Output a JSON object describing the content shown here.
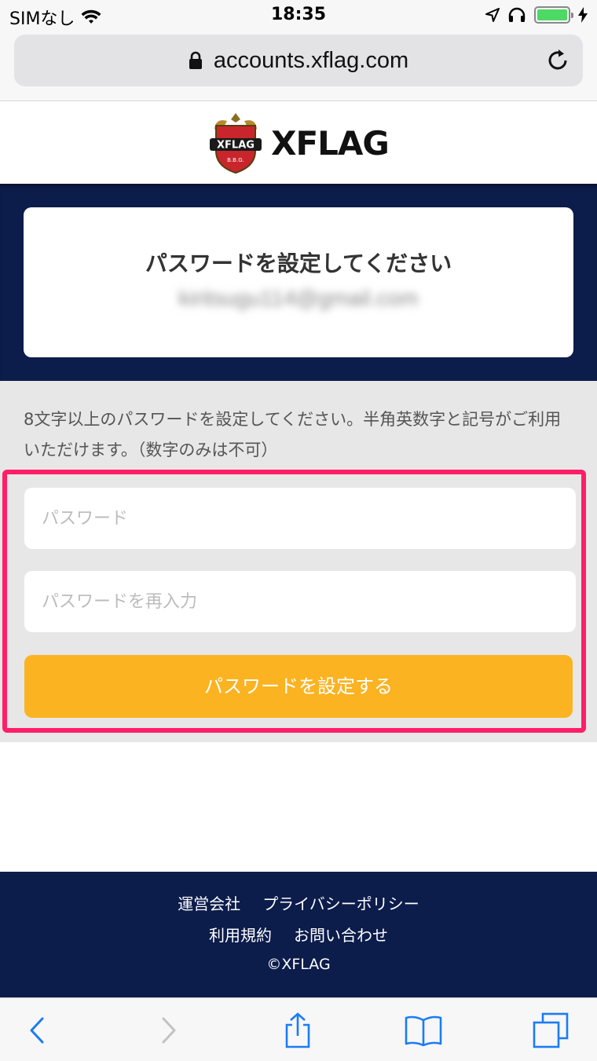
{
  "status_bar": {
    "carrier": "SIMなし",
    "time": "18:35"
  },
  "browser": {
    "url": "accounts.xflag.com"
  },
  "header": {
    "logo_text": "XFLAG"
  },
  "card": {
    "title": "パスワードを設定してください",
    "email": "kiritsugu114@gmail.com"
  },
  "form": {
    "description": "8文字以上のパスワードを設定してください。半角英数字と記号がご利用いただけます。（数字のみは不可）",
    "password_placeholder": "パスワード",
    "password_confirm_placeholder": "パスワードを再入力",
    "submit_label": "パスワードを設定する"
  },
  "footer": {
    "links": [
      "運営会社",
      "プライバシーポリシー",
      "利用規約",
      "お問い合わせ"
    ],
    "copyright": "©XFLAG"
  },
  "colors": {
    "navy": "#0c1c4b",
    "button": "#fbb322",
    "highlight": "#ff1f68",
    "ios_blue": "#1a7cf5"
  },
  "icons": {
    "wifi": "wifi-icon",
    "location": "location-icon",
    "headphones": "headphones-icon",
    "battery": "battery-icon",
    "lock": "lock-icon",
    "reload": "reload-icon",
    "back": "back-icon",
    "forward": "forward-icon",
    "share": "share-icon",
    "bookmarks": "bookmarks-icon",
    "tabs": "tabs-icon"
  }
}
